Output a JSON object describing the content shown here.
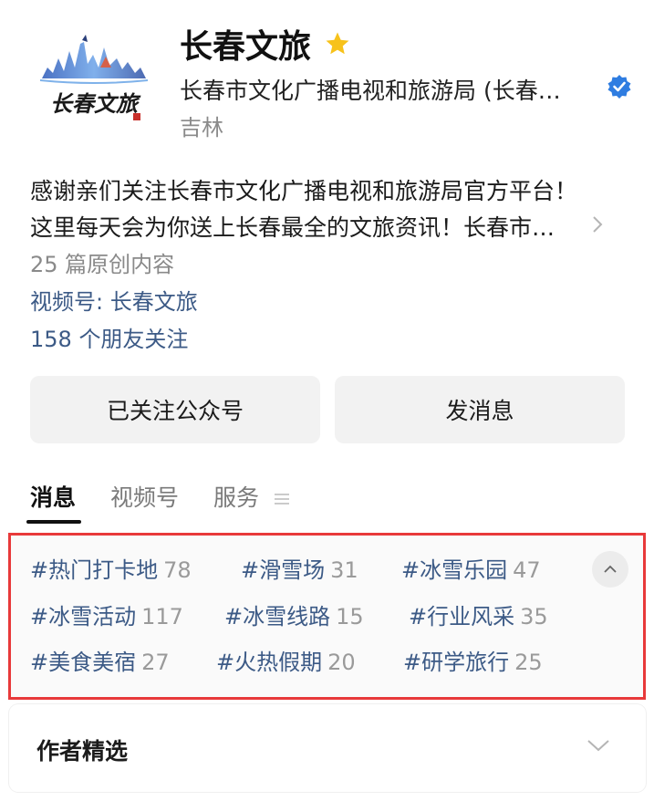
{
  "header": {
    "title": "长春文旅",
    "subtitle": "长春市文化广播电视和旅游局 (长春…",
    "location": "吉林",
    "logo_text": "长春文旅"
  },
  "description": {
    "line1": "感谢亲们关注长春市文化广播电视和旅游局官方平台！",
    "line2": "这里每天会为你送上长春最全的文旅资讯！长春市…"
  },
  "meta": {
    "original": "25 篇原创内容",
    "channel": "视频号: 长春文旅",
    "followers": "158 个朋友关注"
  },
  "buttons": {
    "follow": "已关注公众号",
    "message": "发消息"
  },
  "tabs": [
    {
      "label": "消息"
    },
    {
      "label": "视频号"
    },
    {
      "label": "服务"
    }
  ],
  "tags": [
    {
      "label": "#热门打卡地",
      "count": "78"
    },
    {
      "label": "#滑雪场",
      "count": "31"
    },
    {
      "label": "#冰雪乐园",
      "count": "47"
    },
    {
      "label": "#冰雪活动",
      "count": "117"
    },
    {
      "label": "#冰雪线路",
      "count": "15"
    },
    {
      "label": "#行业风采",
      "count": "35"
    },
    {
      "label": "#美食美宿",
      "count": "27"
    },
    {
      "label": "#火热假期",
      "count": "20"
    },
    {
      "label": "#研学旅行",
      "count": "25"
    }
  ],
  "author_picks": {
    "title": "作者精选"
  },
  "colors": {
    "link": "#3c5a86",
    "highlight_border": "#e8393a",
    "verified": "#2f7de1",
    "star": "#f7c21b"
  }
}
